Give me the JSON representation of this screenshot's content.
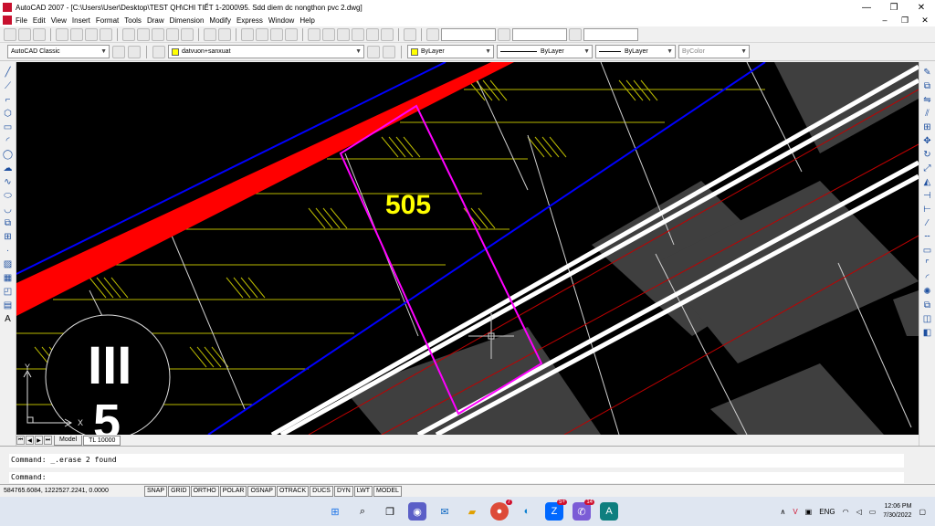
{
  "window": {
    "title": "AutoCAD 2007 - [C:\\Users\\User\\Desktop\\TEST QH\\CHI TIẾT 1-2000\\95. Sdd diem dc nongthon pvc 2.dwg]"
  },
  "menu": [
    "File",
    "Edit",
    "View",
    "Insert",
    "Format",
    "Tools",
    "Draw",
    "Dimension",
    "Modify",
    "Express",
    "Window",
    "Help"
  ],
  "toolbar": {
    "workspace": "AutoCAD Classic",
    "layer": "datvuon+sanxuat",
    "color": "ByLayer",
    "linetype": "ByLayer",
    "lineweight": "ByLayer",
    "plotstyle": "ByColor"
  },
  "drawing": {
    "parcel_label": "505",
    "grid_label_roman": "III",
    "grid_label_number": "5",
    "ucs_y": "Y",
    "ucs_x": "X"
  },
  "tabs": {
    "model": "Model",
    "layout": "TL 10000"
  },
  "command": {
    "history": "Command:  _.erase 2 found",
    "prompt": "Command:"
  },
  "status": {
    "coordinates": "584765.6084, 1222527.2241, 0.0000",
    "toggles": [
      "SNAP",
      "GRID",
      "ORTHO",
      "POLAR",
      "OSNAP",
      "OTRACK",
      "DUCS",
      "DYN",
      "LWT",
      "MODEL"
    ]
  },
  "taskbar": {
    "badges": [
      "7",
      "5+",
      "14"
    ],
    "language": "ENG",
    "time": "12:06 PM",
    "date": "7/30/2022"
  },
  "colors": {
    "canvas": "#000000",
    "parcel": "#ff00ff",
    "road": "#ff0000",
    "boundary": "#0000ff",
    "hatch": "#ffff00",
    "label": "#ffff00"
  }
}
